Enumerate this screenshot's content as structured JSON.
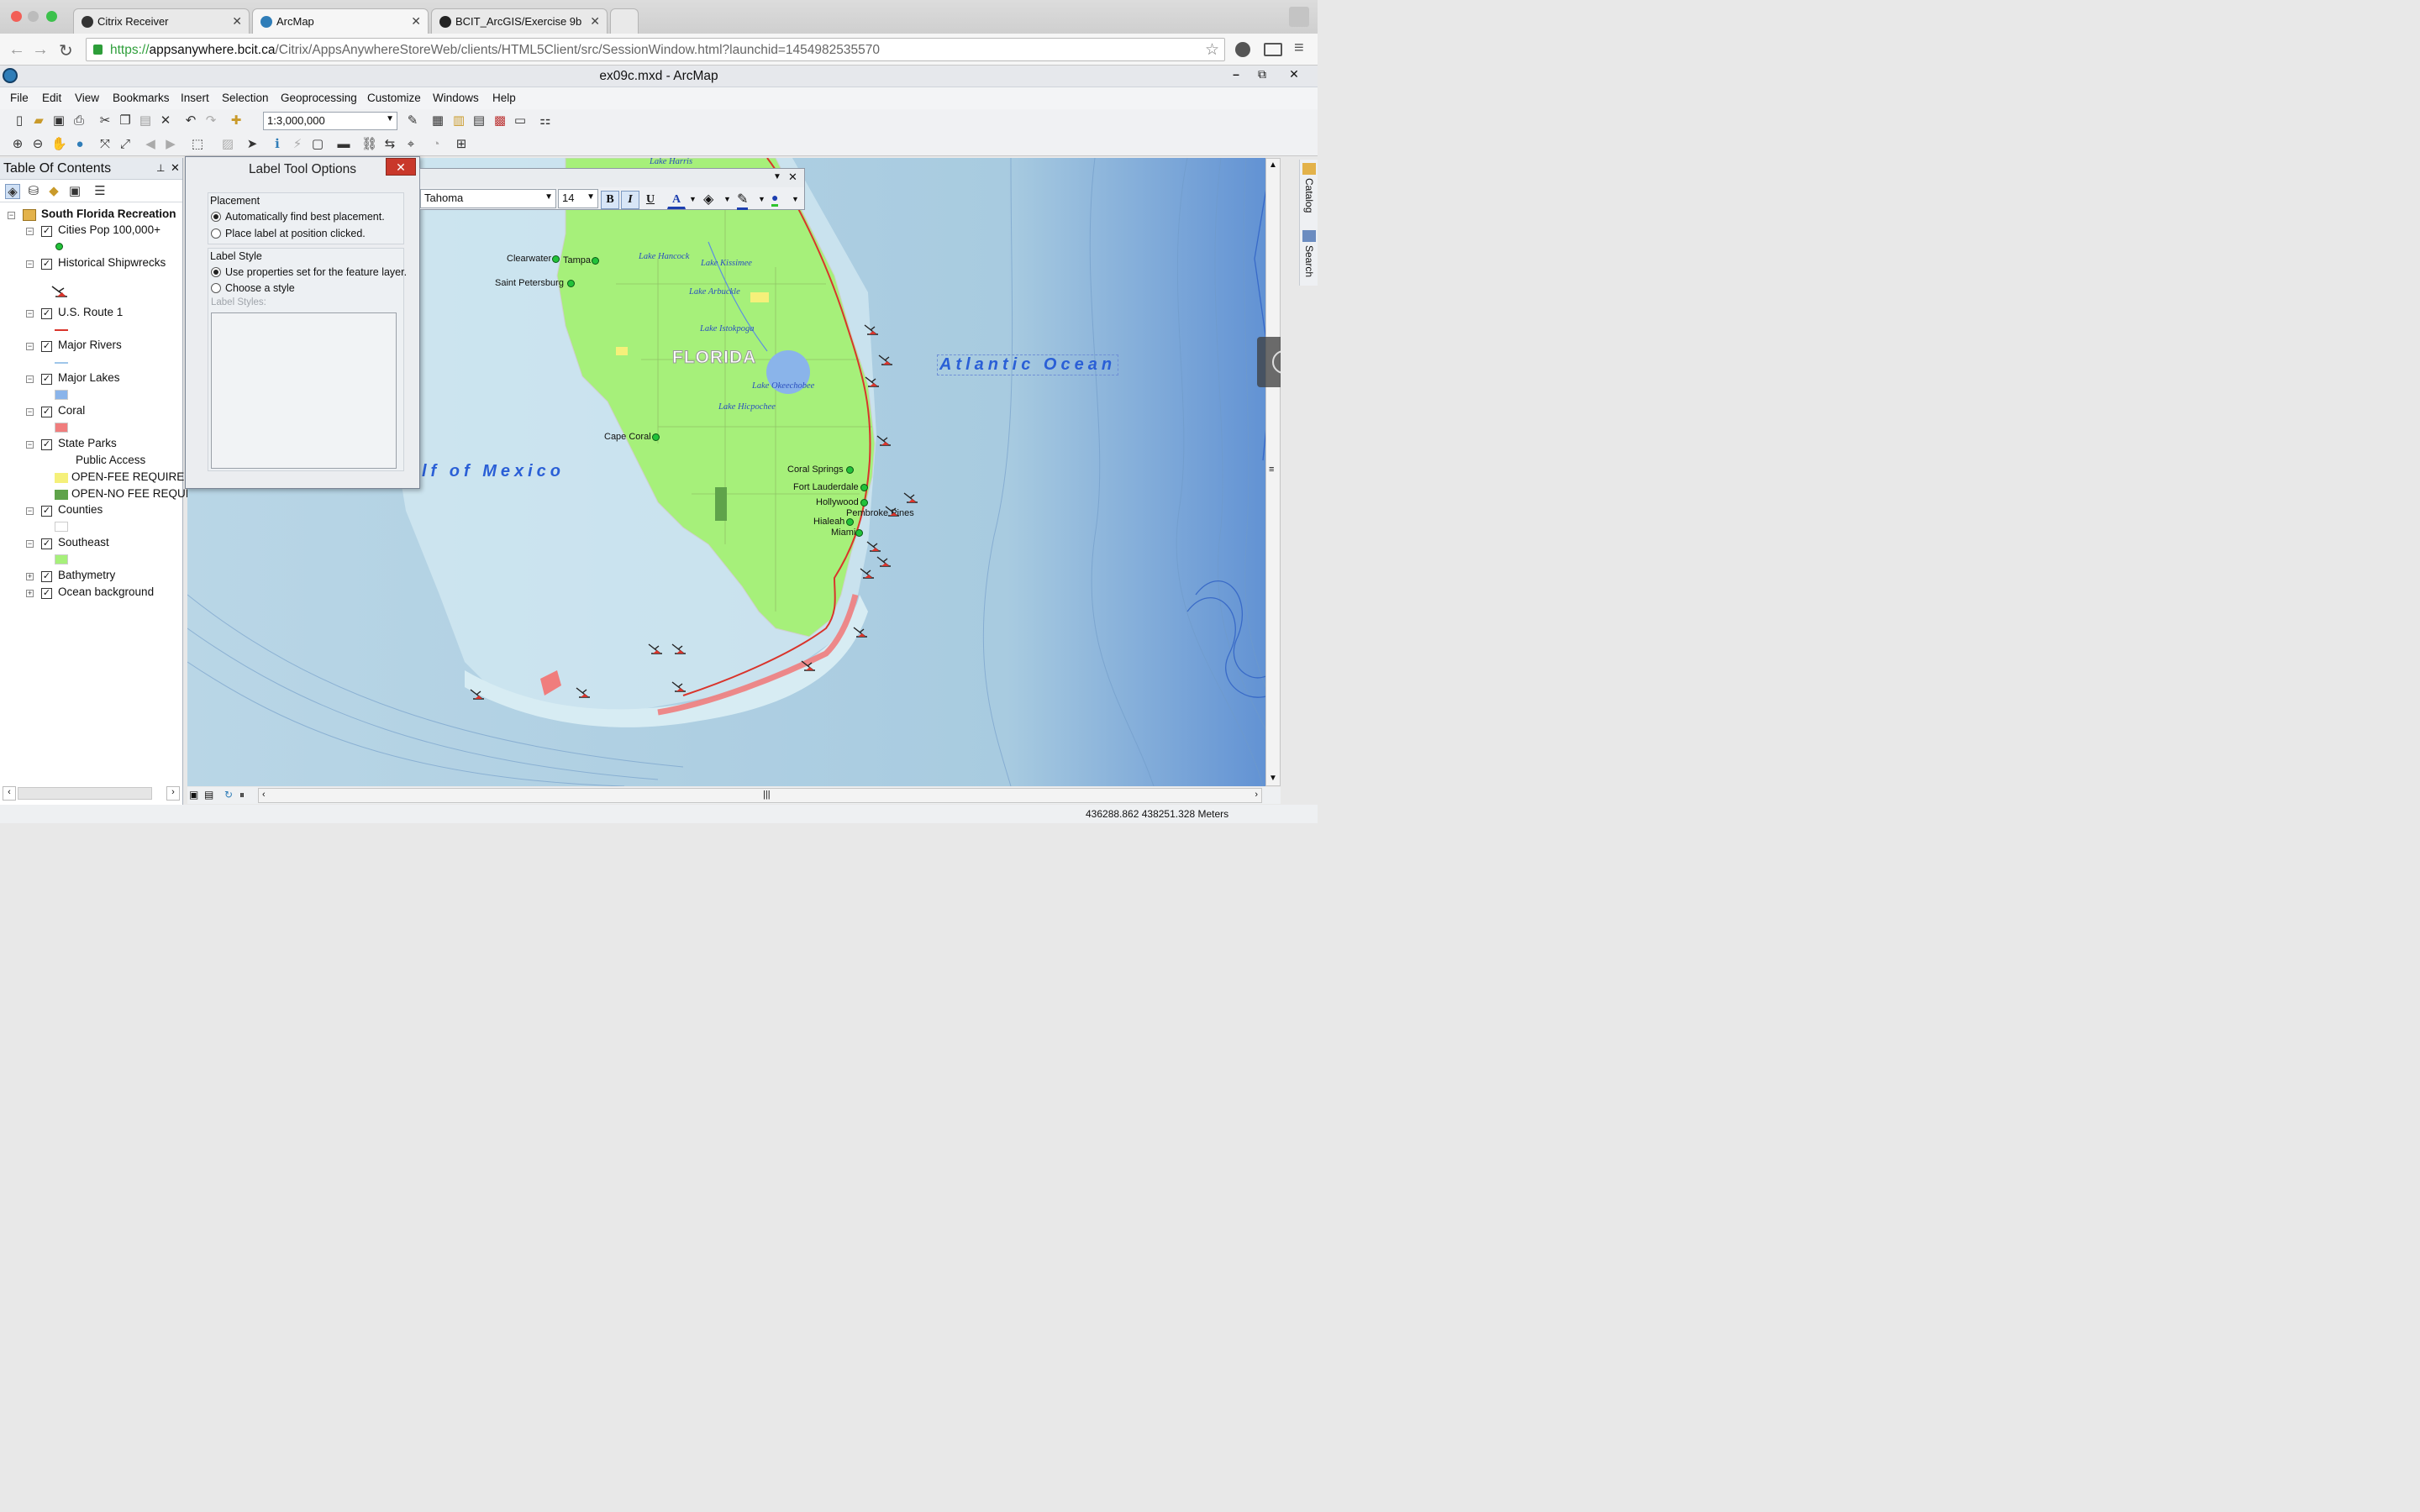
{
  "browser": {
    "tabs": [
      {
        "label": "Citrix Receiver"
      },
      {
        "label": "ArcMap"
      },
      {
        "label": "BCIT_ArcGIS/Exercise 9b"
      }
    ],
    "url_secure": "https://",
    "url_host": "appsanywhere.bcit.ca",
    "url_path": "/Citrix/AppsAnywhereStoreWeb/clients/HTML5Client/src/SessionWindow.html?launchid=1454982535570"
  },
  "app": {
    "title": "ex09c.mxd - ArcMap",
    "window_buttons": [
      "–",
      "⧉",
      "✕"
    ]
  },
  "menus": [
    "File",
    "Edit",
    "View",
    "Bookmarks",
    "Insert",
    "Selection",
    "Geoprocessing",
    "Customize",
    "Windows",
    "Help"
  ],
  "toolbar": {
    "scale": "1:3,000,000"
  },
  "toc": {
    "title": "Table Of Contents",
    "data_frame": "South Florida Recreation",
    "layers": [
      {
        "label": "Cities Pop 100,000+",
        "expanded": true,
        "checked": true
      },
      {
        "label": "Historical Shipwrecks",
        "expanded": true,
        "checked": true
      },
      {
        "label": "U.S. Route 1",
        "expanded": true,
        "checked": true
      },
      {
        "label": "Major Rivers",
        "expanded": true,
        "checked": true
      },
      {
        "label": "Major Lakes",
        "expanded": true,
        "checked": true
      },
      {
        "label": "Coral",
        "expanded": true,
        "checked": true
      },
      {
        "label": "State Parks",
        "expanded": true,
        "checked": true
      },
      {
        "label": "Counties",
        "expanded": true,
        "checked": true
      },
      {
        "label": "Southeast",
        "expanded": true,
        "checked": true
      },
      {
        "label": "Bathymetry",
        "expanded": false,
        "checked": true
      },
      {
        "label": "Ocean background",
        "expanded": false,
        "checked": true
      }
    ],
    "state_parks_field": "Public Access",
    "state_parks_classes": [
      "OPEN-FEE REQUIRED",
      "OPEN-NO FEE REQUIR"
    ],
    "colors": {
      "city": "#22c23a",
      "route": "#d9342b",
      "river": "#9fc6ea",
      "lake": "#8ab4ea",
      "coral": "#f07d7d",
      "park_fee": "#f5f07a",
      "park_nofee": "#5fa34a",
      "counties": "#ffffff",
      "southeast": "#a6f07a"
    }
  },
  "dialog": {
    "title": "Label Tool Options",
    "placement_heading": "Placement",
    "placement_opt1": "Automatically find best placement.",
    "placement_opt2": "Place label at position clicked.",
    "style_heading": "Label Style",
    "style_opt1": "Use properties set for the feature layer.",
    "style_opt2": "Choose a style",
    "styles_label": "Label Styles:"
  },
  "draw_toolbar": {
    "font": "Tahoma",
    "size": "14",
    "bold": "B",
    "italic": "I",
    "underline": "U",
    "font_color": "A"
  },
  "map": {
    "state_label": "FLORIDA",
    "ocean_label": "Atlantic Ocean",
    "gulf_label": "lf of Mexico",
    "cities": [
      "Clearwater",
      "Tampa",
      "Saint Petersburg",
      "Cape Coral",
      "Coral Springs",
      "Fort Lauderdale",
      "Hollywood",
      "Pembroke Pines",
      "Hialeah",
      "Miami"
    ],
    "lakes": [
      "Lake Harris",
      "Lake Hancock",
      "Lake Kissimee",
      "Lake Arbuckle",
      "Lake Istokpoga",
      "Lake Okeechobee",
      "Lake Hicpochee"
    ]
  },
  "side_tabs": [
    "Catalog",
    "Search"
  ],
  "status": {
    "coords": "436288.862  438251.328 Meters"
  }
}
